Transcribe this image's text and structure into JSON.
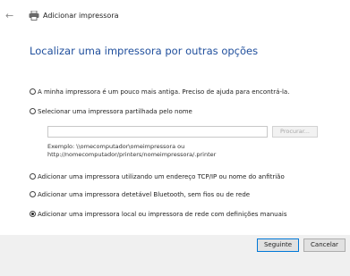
{
  "window": {
    "title": "Adicionar impressora",
    "back_glyph": "←",
    "title_icon": "printer-icon"
  },
  "main": {
    "heading": "Localizar uma impressora por outras opções",
    "options": [
      {
        "label": "A minha impressora é um pouco mais antiga. Preciso de ajuda para encontrá-la.",
        "selected": false
      },
      {
        "label": "Selecionar uma impressora partilhada pelo nome",
        "selected": false
      },
      {
        "label": "Adicionar uma impressora utilizando um endereço TCP/IP ou nome do anfitrião",
        "selected": false
      },
      {
        "label": "Adicionar uma impressora detetável Bluetooth, sem fios ou de rede",
        "selected": false
      },
      {
        "label": "Adicionar uma impressora local ou impressora de rede com definições manuais",
        "selected": true
      }
    ],
    "share_input": {
      "value": "",
      "placeholder": ""
    },
    "browse_label": "Procurar...",
    "example_line1": "Exemplo: \\\\omecomputador\\omeimpressora ou",
    "example_line2": "http://nomecomputador/printers/nomeimpressora/.printer"
  },
  "footer": {
    "next_label": "Seguinte",
    "cancel_label": "Cancelar"
  },
  "colors": {
    "heading": "#1f4e9c",
    "primary_border": "#0078d7",
    "footer_bg": "#f0f0f0"
  }
}
